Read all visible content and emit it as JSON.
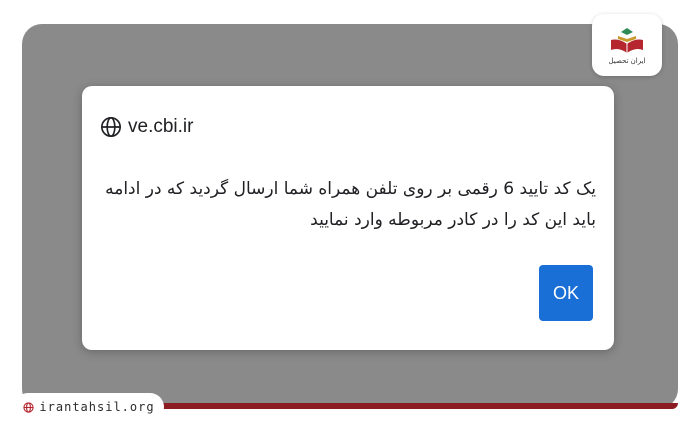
{
  "dialog": {
    "origin": "ve.cbi.ir",
    "message": "یک کد تایید 6 رقمی بر روی تلفن همراه شما ارسال گردید که در ادامه باید این کد را در کادر مربوطه وارد نمایید",
    "ok_label": "OK",
    "origin_icon": "globe-icon"
  },
  "watermark": {
    "logo_text": "ایران تحصیل",
    "site_url": "irantahsil.org",
    "site_icon": "globe-icon"
  },
  "colors": {
    "backdrop": "#8a8a8a",
    "button": "#1a6fd6",
    "stripe": "#8a1c22"
  }
}
